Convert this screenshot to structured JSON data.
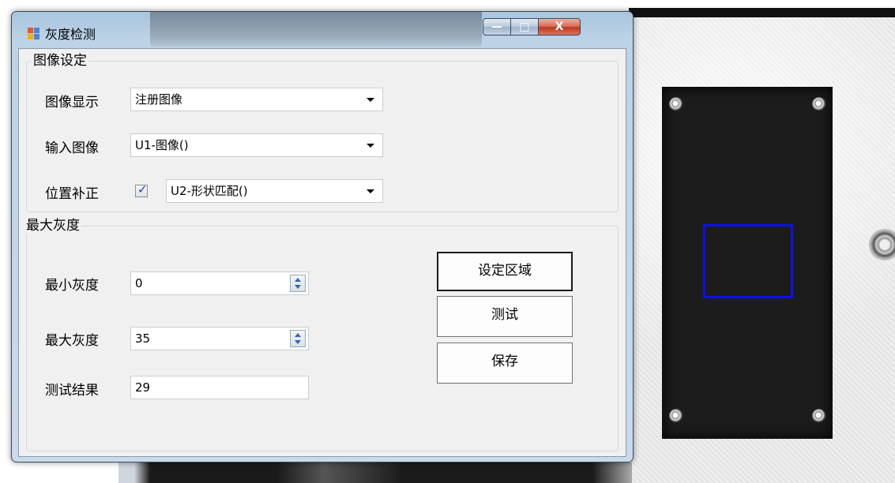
{
  "window": {
    "title": "灰度检测",
    "controls": {
      "minimize": "—",
      "maximize": "□",
      "close": "X"
    }
  },
  "image_settings": {
    "legend": "图像设定",
    "display_label": "图像显示",
    "display_value": "注册图像",
    "input_label": "输入图像",
    "input_value": "U1-图像()",
    "position_label": "位置补正",
    "position_checked": true,
    "position_value": "U2-形状匹配()"
  },
  "max_gray": {
    "legend": "最大灰度",
    "min_gray_label": "最小灰度",
    "min_gray_value": "0",
    "max_gray_label": "最大灰度",
    "max_gray_value": "35",
    "result_label": "测试结果",
    "result_value": "29"
  },
  "buttons": {
    "set_region": "设定区域",
    "test": "测试",
    "save": "保存"
  },
  "colors": {
    "roi_box": "#1010e8",
    "close_button": "#c2381f"
  }
}
